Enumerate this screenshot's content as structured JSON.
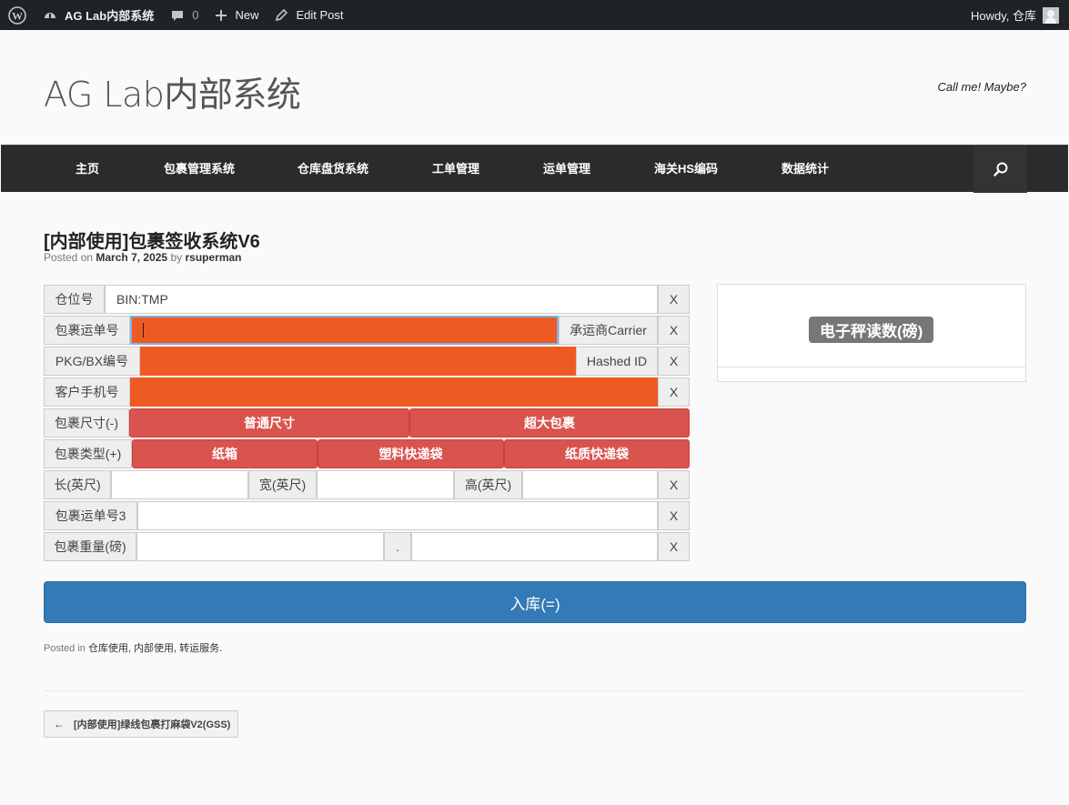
{
  "admin_bar": {
    "site_name": "AG Lab内部系统",
    "comments_count": "0",
    "new_label": "New",
    "edit_label": "Edit Post",
    "howdy": "Howdy, 仓库"
  },
  "header": {
    "site_title": "AG Lab内部系统",
    "tagline": "Call me! Maybe?"
  },
  "nav": {
    "items": [
      "主页",
      "包裹管理系统",
      "仓库盘货系统",
      "工单管理",
      "运单管理",
      "海关HS编码",
      "数据统计"
    ]
  },
  "post": {
    "title": "[内部使用]包裹签收系统V6",
    "posted_on": "Posted on",
    "date": "March 7, 2025",
    "by": "by",
    "author": "rsuperman"
  },
  "form": {
    "bin_label": "仓位号",
    "bin_value": "BIN:TMP",
    "tracking_label": "包裹运单号",
    "carrier_label": "承运商Carrier",
    "pkg_label": "PKG/BX编号",
    "hashed_label": "Hashed ID",
    "phone_label": "客户手机号",
    "size_label": "包裹尺寸(-)",
    "size_options": [
      "普通尺寸",
      "超大包裹"
    ],
    "type_label": "包裹类型(+)",
    "type_options": [
      "纸箱",
      "塑料快递袋",
      "纸质快递袋"
    ],
    "length_label": "长(英尺)",
    "width_label": "宽(英尺)",
    "height_label": "高(英尺)",
    "tracking3_label": "包裹运单号3",
    "weight_label": "包裹重量(磅)",
    "decimal": ".",
    "clear": "X"
  },
  "scale": {
    "label": "电子秤读数(磅)"
  },
  "submit_label": "入库(=)",
  "footer": {
    "posted_in": "Posted in",
    "categories": "仓库使用, 内部使用, 转运服务."
  },
  "prev_post": {
    "arrow": "←",
    "title": "[内部使用]绿线包裹打麻袋V2(GSS)"
  },
  "colors": {
    "orange": "#ee5b22",
    "red_button": "#d9534f",
    "blue_button": "#337ab7",
    "admin_bar": "#1d2327",
    "nav_bg": "#2b2b2b"
  }
}
